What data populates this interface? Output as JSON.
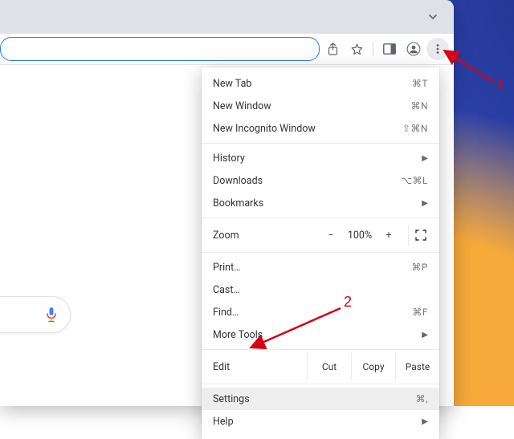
{
  "toolbar": {
    "share_icon": "share-icon",
    "star_icon": "star-icon",
    "panel_icon": "side-panel-icon",
    "profile_icon": "profile-icon",
    "more_icon": "more-vert-icon"
  },
  "menu": {
    "new_tab": {
      "label": "New Tab",
      "shortcut": "⌘T"
    },
    "new_window": {
      "label": "New Window",
      "shortcut": "⌘N"
    },
    "new_incognito": {
      "label": "New Incognito Window",
      "shortcut": "⇧⌘N"
    },
    "history": {
      "label": "History"
    },
    "downloads": {
      "label": "Downloads",
      "shortcut": "⌥⌘L"
    },
    "bookmarks": {
      "label": "Bookmarks"
    },
    "zoom": {
      "label": "Zoom",
      "minus": "−",
      "value": "100%",
      "plus": "+"
    },
    "print": {
      "label": "Print…",
      "shortcut": "⌘P"
    },
    "cast": {
      "label": "Cast…"
    },
    "find": {
      "label": "Find…",
      "shortcut": "⌘F"
    },
    "more_tools": {
      "label": "More Tools"
    },
    "edit": {
      "label": "Edit",
      "cut": "Cut",
      "copy": "Copy",
      "paste": "Paste"
    },
    "settings": {
      "label": "Settings",
      "shortcut": "⌘,"
    },
    "help": {
      "label": "Help"
    }
  },
  "annotations": {
    "one": "1",
    "two": "2"
  }
}
